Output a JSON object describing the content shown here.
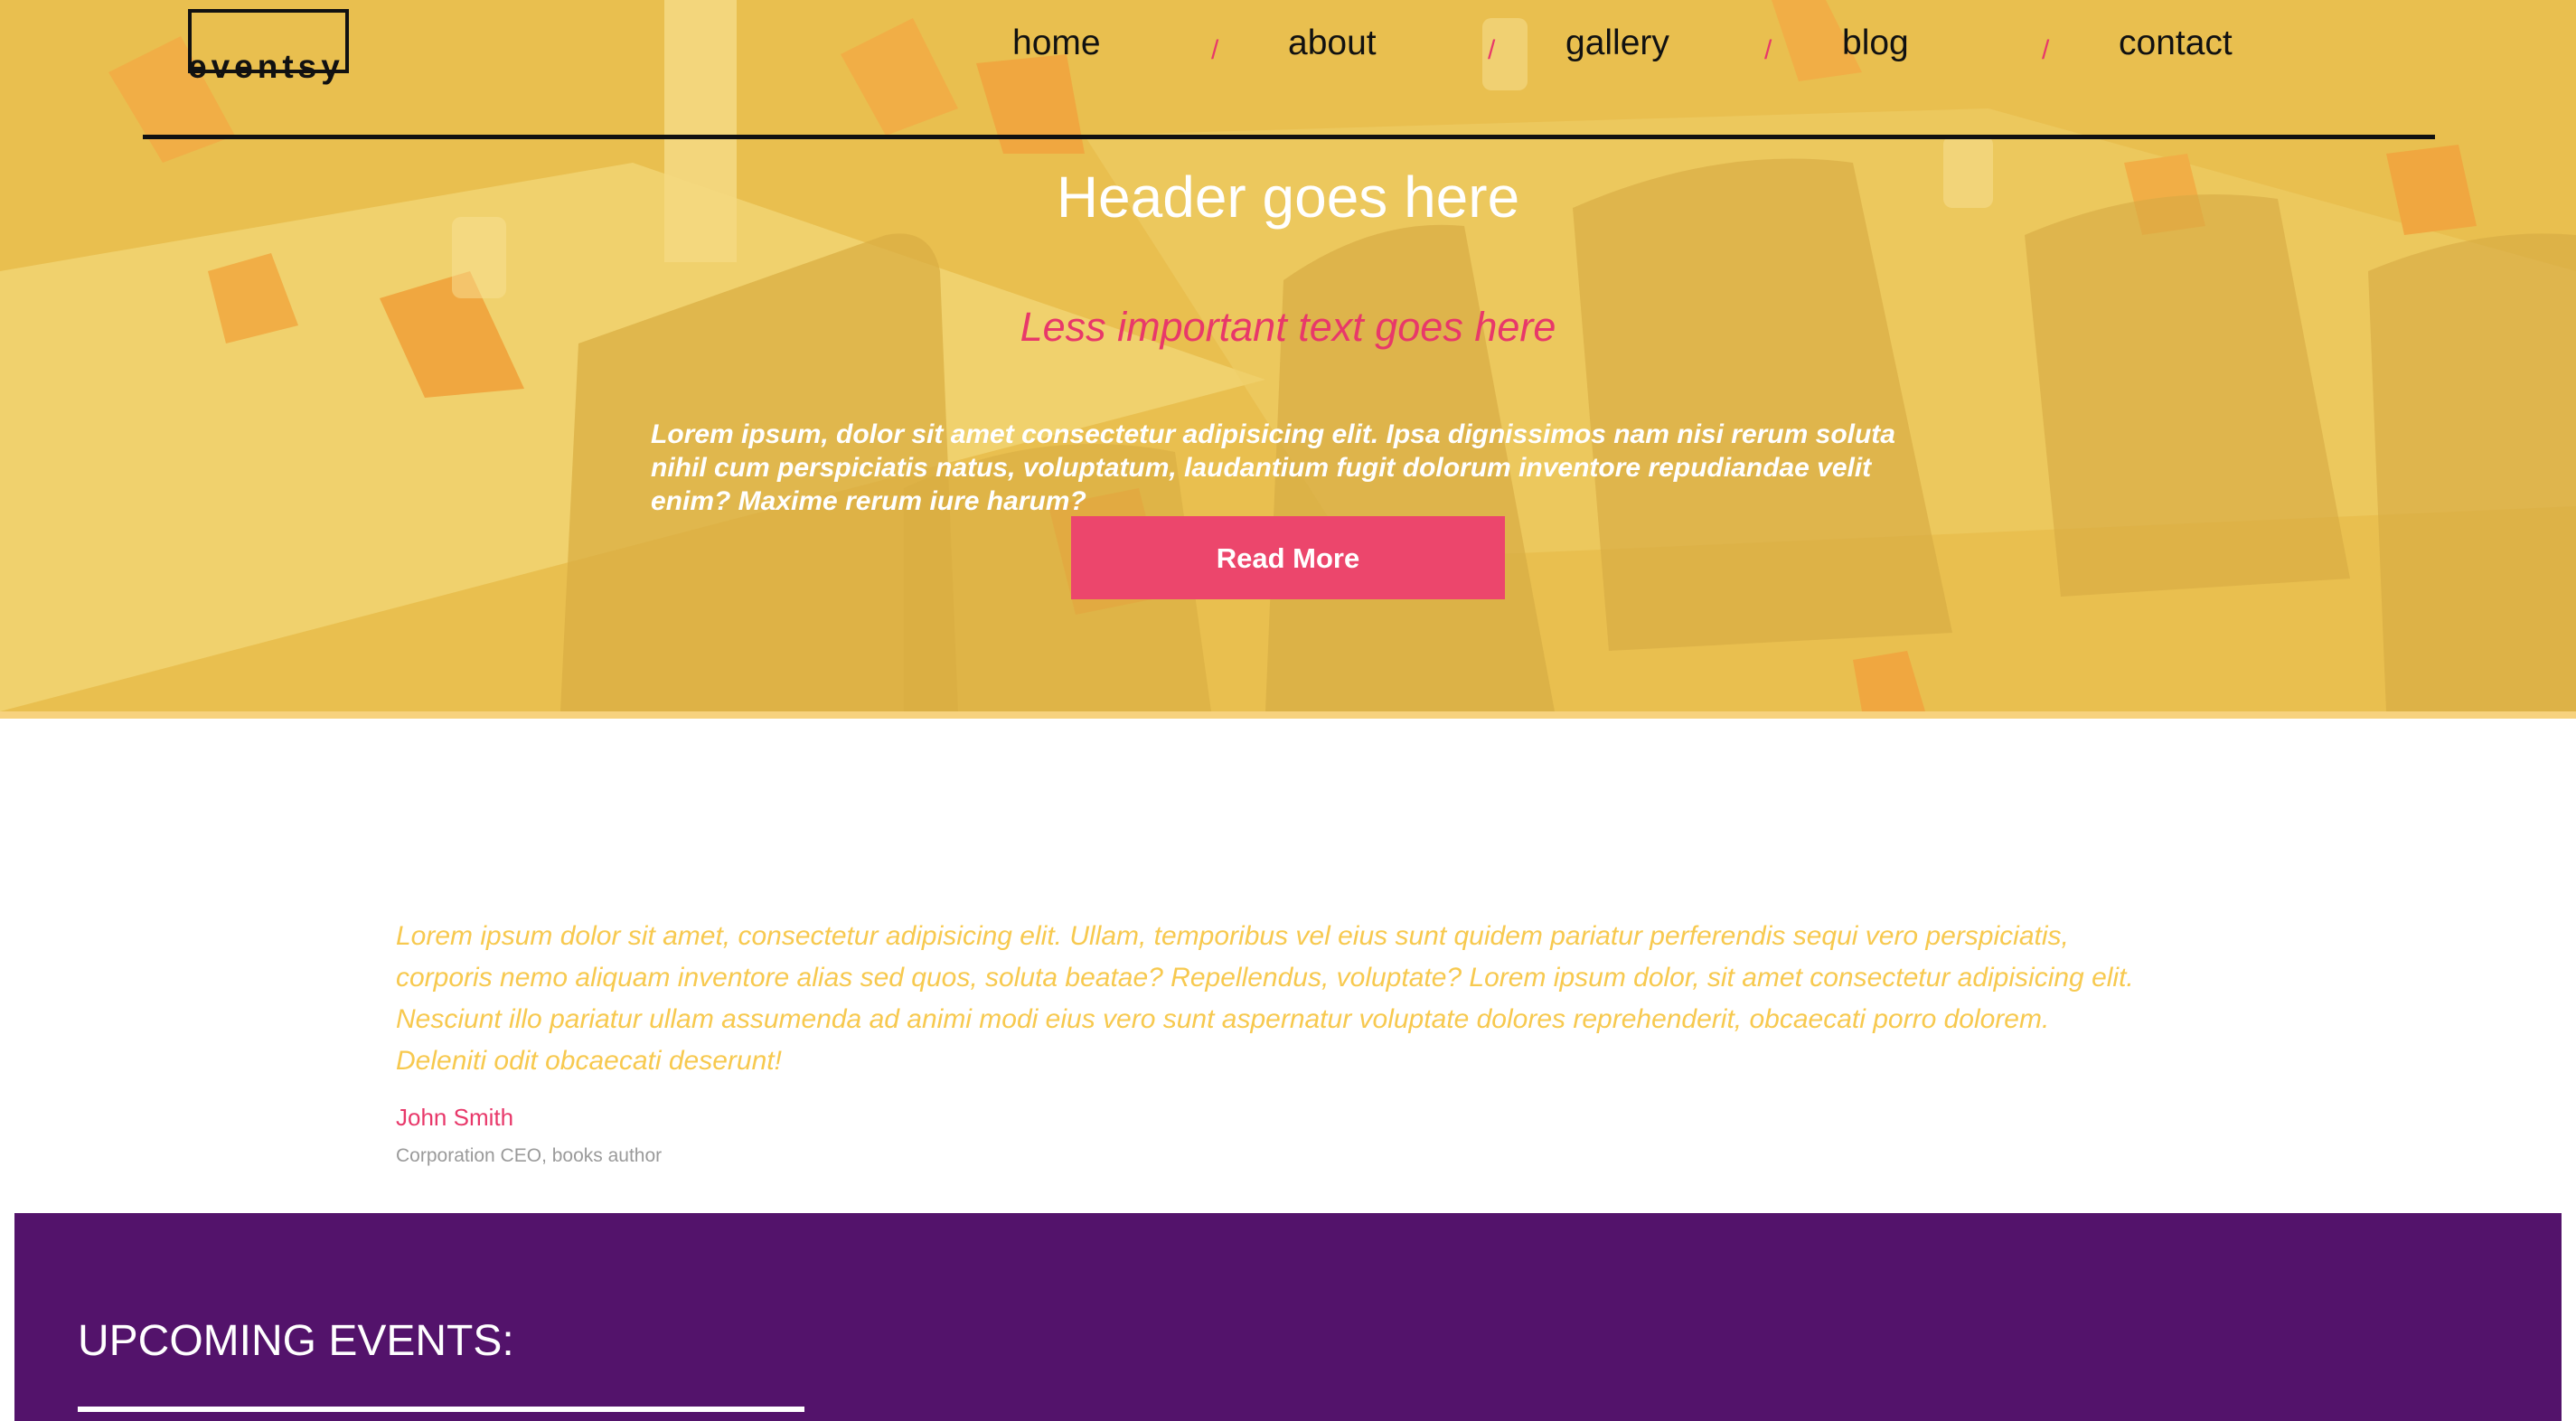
{
  "brand": {
    "logo_text": "eventsy"
  },
  "nav": {
    "items": [
      "home",
      "about",
      "gallery",
      "blog",
      "contact"
    ],
    "separator": "/"
  },
  "hero": {
    "title": "Header goes here",
    "subtitle": "Less important text goes here",
    "body": "Lorem ipsum, dolor sit amet consectetur adipisicing elit. Ipsa dignissimos nam nisi rerum soluta nihil cum perspiciatis natus, voluptatum, laudantium fugit dolorum inventore repudiandae velit enim? Maxime rerum iure harum?",
    "button_label": "Read More"
  },
  "testimonial": {
    "quote": "Lorem ipsum dolor sit amet, consectetur adipisicing elit. Ullam, temporibus vel eius sunt quidem pariatur perferendis sequi vero perspiciatis, corporis nemo aliquam inventore alias sed quos, soluta beatae? Repellendus, voluptate? Lorem ipsum dolor, sit amet consectetur adipisicing elit. Nesciunt illo pariatur ullam assumenda ad animi modi eius vero sunt aspernatur voluptate dolores reprehenderit, obcaecati porro dolorem. Deleniti odit obcaecati deserunt!",
    "author": "John Smith",
    "role": "Corporation CEO, books author"
  },
  "events": {
    "title": "UPCOMING EVENTS:"
  },
  "colors": {
    "accent_pink": "#ec466c",
    "hero_yellow": "#e6bd55",
    "quote_yellow": "#f7c94f",
    "events_purple": "#53136b"
  }
}
